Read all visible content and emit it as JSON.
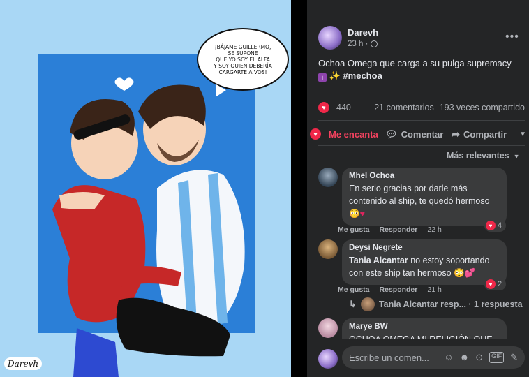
{
  "artwork": {
    "speech_bubble": "¡BÁJAME GUILLERMO,\nSE SUPONE\nQUE YO SOY EL ALFA\nY SOY QUIEN DEBERÍA\nCARGARTE A VOS!",
    "signature": "Darevh"
  },
  "post": {
    "author": "Darevh",
    "time": "23 h ·",
    "caption_text": "Ochoa Omega que carga a su pulga supremacy",
    "caption_hashtag": "#mechoa",
    "reaction_count": "440",
    "comments_count": "21 comentarios",
    "shares_count": "193 veces compartido"
  },
  "actions": {
    "love_label": "Me encanta",
    "comment_label": "Comentar",
    "share_label": "Compartir"
  },
  "sort_label": "Más relevantes",
  "comments": [
    {
      "name": "Mhel Ochoa",
      "text": "En serio gracias por darle más contenido al ship, te quedó hermoso",
      "like": "Me gusta",
      "reply": "Responder",
      "time": "22 h",
      "reactions": "4"
    },
    {
      "name": "Deysi Negrete",
      "mention": "Tania Alcantar",
      "text": " no estoy soportando con este ship tan hermoso",
      "like": "Me gusta",
      "reply": "Responder",
      "time": "21 h",
      "reactions": "2"
    },
    {
      "name": "Marye BW",
      "text": "OCHOA OMEGA MI RELIGIÓN QUE"
    }
  ],
  "reply_preview": {
    "text": "Tania Alcantar resp... · 1 respuesta"
  },
  "composer": {
    "placeholder": "Escribe un comen..."
  },
  "colors": {
    "panel_bg": "#242526",
    "bubble_bg": "#3a3b3c",
    "love_red": "#f3425f",
    "text_primary": "#e4e6eb",
    "text_secondary": "#b0b3b8"
  }
}
